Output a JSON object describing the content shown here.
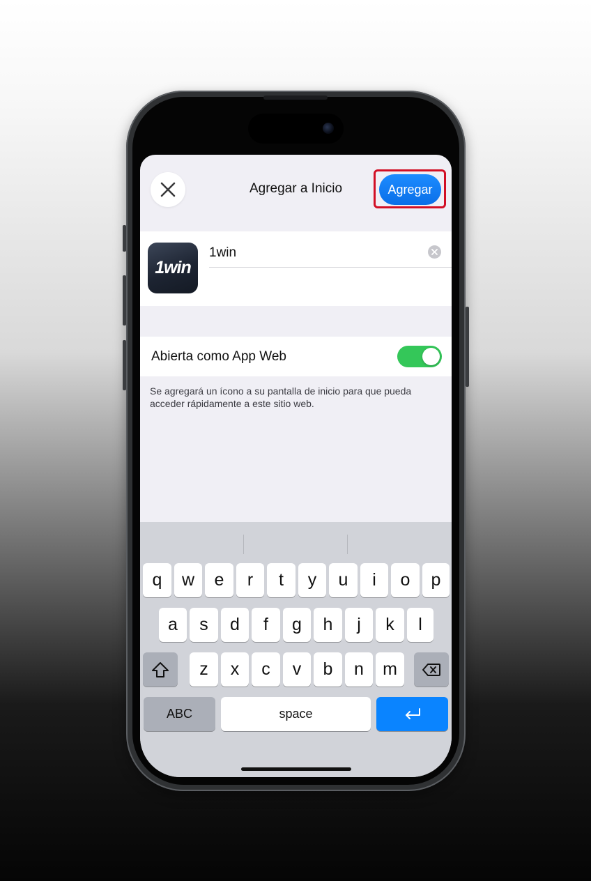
{
  "header": {
    "title": "Agregar a Inicio",
    "add_label": "Agregar"
  },
  "app": {
    "icon_text": "1win",
    "name_value": "1win"
  },
  "web_app": {
    "label": "Abierta como App Web",
    "enabled": true
  },
  "footnote": "Se agregará un ícono a su pantalla de inicio para que pueda acceder rápidamente a este sitio web.",
  "keyboard": {
    "row1": [
      "q",
      "w",
      "e",
      "r",
      "t",
      "y",
      "u",
      "i",
      "o",
      "p"
    ],
    "row2": [
      "a",
      "s",
      "d",
      "f",
      "g",
      "h",
      "j",
      "k",
      "l"
    ],
    "row3": [
      "z",
      "x",
      "c",
      "v",
      "b",
      "n",
      "m"
    ],
    "abc_label": "ABC",
    "space_label": "space"
  },
  "icons": {
    "close": "close-icon",
    "clear": "clear-icon",
    "shift": "shift-icon",
    "backspace": "backspace-icon",
    "return": "return-icon"
  },
  "colors": {
    "accent": "#0a84ff",
    "toggle_on": "#34c759",
    "highlight": "#d20f25"
  }
}
